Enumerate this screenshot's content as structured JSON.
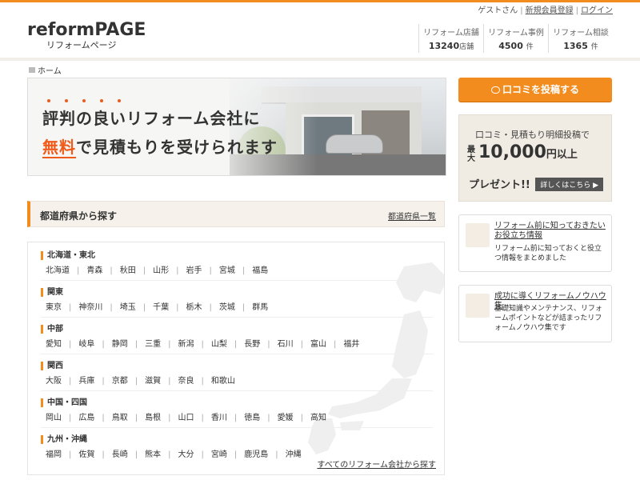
{
  "header": {
    "user_greeting": "ゲストさん",
    "register_label": "新規会員登録",
    "login_label": "ログイン",
    "logo_main": "reformPAGE",
    "logo_sub": "リフォームページ",
    "stats": [
      {
        "label": "リフォーム店舗",
        "value": "13240",
        "unit": "店舗"
      },
      {
        "label": "リフォーム事例",
        "value": "4500",
        "unit": "件"
      },
      {
        "label": "リフォーム相談",
        "value": "1365",
        "unit": "件"
      }
    ]
  },
  "breadcrumb": {
    "home": "ホーム"
  },
  "hero": {
    "line1": "評判の良いリフォーム会社に",
    "line2_em": "無料",
    "line2_rest": "で見積もりを受けられます"
  },
  "prefecture_section": {
    "title": "都道府県から探す",
    "list_link": "都道府県一覧",
    "regions": [
      {
        "name": "北海道・東北",
        "prefs": [
          "北海道",
          "青森",
          "秋田",
          "山形",
          "岩手",
          "宮城",
          "福島"
        ]
      },
      {
        "name": "関東",
        "prefs": [
          "東京",
          "神奈川",
          "埼玉",
          "千葉",
          "栃木",
          "茨城",
          "群馬"
        ]
      },
      {
        "name": "中部",
        "prefs": [
          "愛知",
          "岐阜",
          "静岡",
          "三重",
          "新潟",
          "山梨",
          "長野",
          "石川",
          "富山",
          "福井"
        ]
      },
      {
        "name": "関西",
        "prefs": [
          "大阪",
          "兵庫",
          "京都",
          "滋賀",
          "奈良",
          "和歌山"
        ]
      },
      {
        "name": "中国・四国",
        "prefs": [
          "岡山",
          "広島",
          "鳥取",
          "島根",
          "山口",
          "香川",
          "徳島",
          "愛媛",
          "高知"
        ]
      },
      {
        "name": "九州・沖縄",
        "prefs": [
          "福岡",
          "佐賀",
          "長崎",
          "熊本",
          "大分",
          "宮崎",
          "鹿児島",
          "沖縄"
        ]
      }
    ],
    "all_link": "すべてのリフォーム会社から探す"
  },
  "sidebar": {
    "post_button": "口コミを投稿する",
    "present": {
      "line1": "口コミ・見積もり明細投稿で",
      "max": "最大",
      "amount": "10,000",
      "amount_unit": "円以上",
      "line3": "プレゼント!!",
      "more": "詳しくはこちら"
    },
    "cards": [
      {
        "title": "リフォーム前に知っておきたいお役立ち情報",
        "desc": "リフォーム前に知っておくと役立つ情報をまとめました",
        "icon": "house-icon"
      },
      {
        "title": "成功に導くリフォームノウハウ集",
        "desc": "基礎知識やメンテナンス、リフォームポイントなどが詰まったリフォームノウハウ集です",
        "icon": "building-icon"
      }
    ]
  },
  "colors": {
    "accent": "#f28c1e",
    "emphasis": "#f05a1a",
    "panel": "#f1ece3"
  }
}
